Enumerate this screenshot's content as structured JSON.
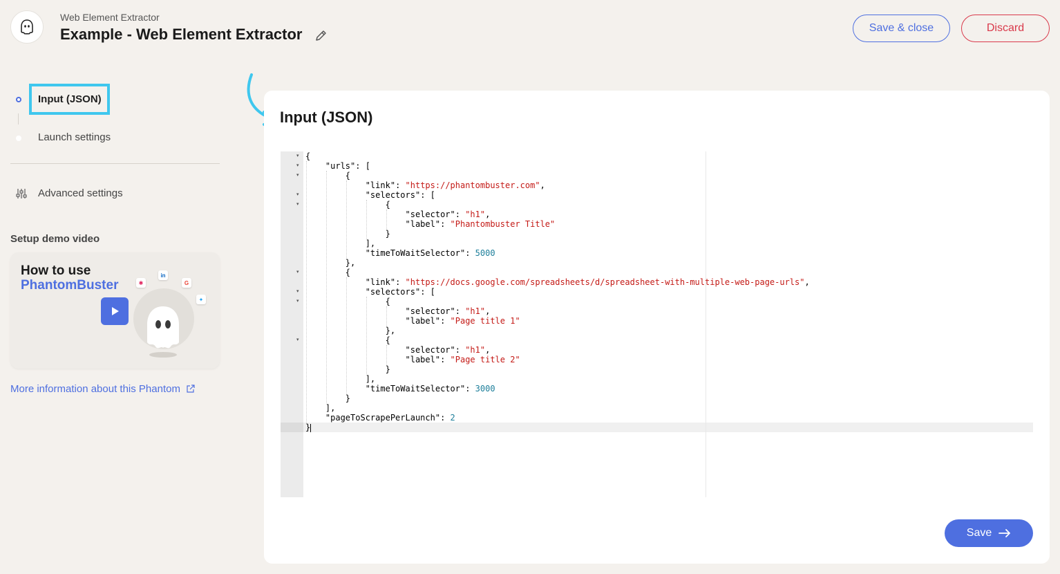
{
  "header": {
    "subtitle": "Web Element Extractor",
    "title": "Example - Web Element Extractor",
    "save_close_label": "Save & close",
    "discard_label": "Discard"
  },
  "sidebar": {
    "steps": [
      {
        "label": "Input (JSON)",
        "active": true
      },
      {
        "label": "Launch settings",
        "active": false
      }
    ],
    "advanced_label": "Advanced settings",
    "demo_heading": "Setup demo video",
    "video": {
      "title_line1": "How to use",
      "title_line2": "PhantomBuster"
    },
    "more_info_label": "More information about this Phantom"
  },
  "main": {
    "title": "Input (JSON)",
    "save_label": "Save"
  },
  "editor": {
    "lines": [
      [
        {
          "t": "{",
          "c": "p"
        }
      ],
      [
        {
          "t": "    ",
          "c": "p"
        },
        {
          "t": "\"urls\"",
          "c": "k"
        },
        {
          "t": ": [",
          "c": "p"
        }
      ],
      [
        {
          "t": "        {",
          "c": "p"
        }
      ],
      [
        {
          "t": "            ",
          "c": "p"
        },
        {
          "t": "\"link\"",
          "c": "k"
        },
        {
          "t": ": ",
          "c": "p"
        },
        {
          "t": "\"https://phantombuster.com\"",
          "c": "s"
        },
        {
          "t": ",",
          "c": "p"
        }
      ],
      [
        {
          "t": "            ",
          "c": "p"
        },
        {
          "t": "\"selectors\"",
          "c": "k"
        },
        {
          "t": ": [",
          "c": "p"
        }
      ],
      [
        {
          "t": "                {",
          "c": "p"
        }
      ],
      [
        {
          "t": "                    ",
          "c": "p"
        },
        {
          "t": "\"selector\"",
          "c": "k"
        },
        {
          "t": ": ",
          "c": "p"
        },
        {
          "t": "\"h1\"",
          "c": "s"
        },
        {
          "t": ",",
          "c": "p"
        }
      ],
      [
        {
          "t": "                    ",
          "c": "p"
        },
        {
          "t": "\"label\"",
          "c": "k"
        },
        {
          "t": ": ",
          "c": "p"
        },
        {
          "t": "\"Phantombuster Title\"",
          "c": "s"
        }
      ],
      [
        {
          "t": "                }",
          "c": "p"
        }
      ],
      [
        {
          "t": "            ],",
          "c": "p"
        }
      ],
      [
        {
          "t": "            ",
          "c": "p"
        },
        {
          "t": "\"timeToWaitSelector\"",
          "c": "k"
        },
        {
          "t": ": ",
          "c": "p"
        },
        {
          "t": "5000",
          "c": "n"
        }
      ],
      [
        {
          "t": "        },",
          "c": "p"
        }
      ],
      [
        {
          "t": "        {",
          "c": "p"
        }
      ],
      [
        {
          "t": "            ",
          "c": "p"
        },
        {
          "t": "\"link\"",
          "c": "k"
        },
        {
          "t": ": ",
          "c": "p"
        },
        {
          "t": "\"https://docs.google.com/spreadsheets/d/spreadsheet-with-multiple-web-page-urls\"",
          "c": "s"
        },
        {
          "t": ",",
          "c": "p"
        }
      ],
      [
        {
          "t": "            ",
          "c": "p"
        },
        {
          "t": "\"selectors\"",
          "c": "k"
        },
        {
          "t": ": [",
          "c": "p"
        }
      ],
      [
        {
          "t": "                {",
          "c": "p"
        }
      ],
      [
        {
          "t": "                    ",
          "c": "p"
        },
        {
          "t": "\"selector\"",
          "c": "k"
        },
        {
          "t": ": ",
          "c": "p"
        },
        {
          "t": "\"h1\"",
          "c": "s"
        },
        {
          "t": ",",
          "c": "p"
        }
      ],
      [
        {
          "t": "                    ",
          "c": "p"
        },
        {
          "t": "\"label\"",
          "c": "k"
        },
        {
          "t": ": ",
          "c": "p"
        },
        {
          "t": "\"Page title 1\"",
          "c": "s"
        }
      ],
      [
        {
          "t": "                },",
          "c": "p"
        }
      ],
      [
        {
          "t": "                {",
          "c": "p"
        }
      ],
      [
        {
          "t": "                    ",
          "c": "p"
        },
        {
          "t": "\"selector\"",
          "c": "k"
        },
        {
          "t": ": ",
          "c": "p"
        },
        {
          "t": "\"h1\"",
          "c": "s"
        },
        {
          "t": ",",
          "c": "p"
        }
      ],
      [
        {
          "t": "                    ",
          "c": "p"
        },
        {
          "t": "\"label\"",
          "c": "k"
        },
        {
          "t": ": ",
          "c": "p"
        },
        {
          "t": "\"Page title 2\"",
          "c": "s"
        }
      ],
      [
        {
          "t": "                }",
          "c": "p"
        }
      ],
      [
        {
          "t": "            ],",
          "c": "p"
        }
      ],
      [
        {
          "t": "            ",
          "c": "p"
        },
        {
          "t": "\"timeToWaitSelector\"",
          "c": "k"
        },
        {
          "t": ": ",
          "c": "p"
        },
        {
          "t": "3000",
          "c": "n"
        }
      ],
      [
        {
          "t": "        }",
          "c": "p"
        }
      ],
      [
        {
          "t": "    ],",
          "c": "p"
        }
      ],
      [
        {
          "t": "    ",
          "c": "p"
        },
        {
          "t": "\"pageToScrapePerLaunch\"",
          "c": "k"
        },
        {
          "t": ": ",
          "c": "p"
        },
        {
          "t": "2",
          "c": "n"
        }
      ],
      [
        {
          "t": "}",
          "c": "p"
        }
      ]
    ],
    "fold_lines": [
      0,
      1,
      2,
      4,
      5,
      12,
      14,
      15,
      19
    ]
  },
  "colors": {
    "accent": "#4e6fe0",
    "danger": "#d9384a",
    "highlight": "#3fc7ee",
    "background": "#f4f1ed"
  }
}
